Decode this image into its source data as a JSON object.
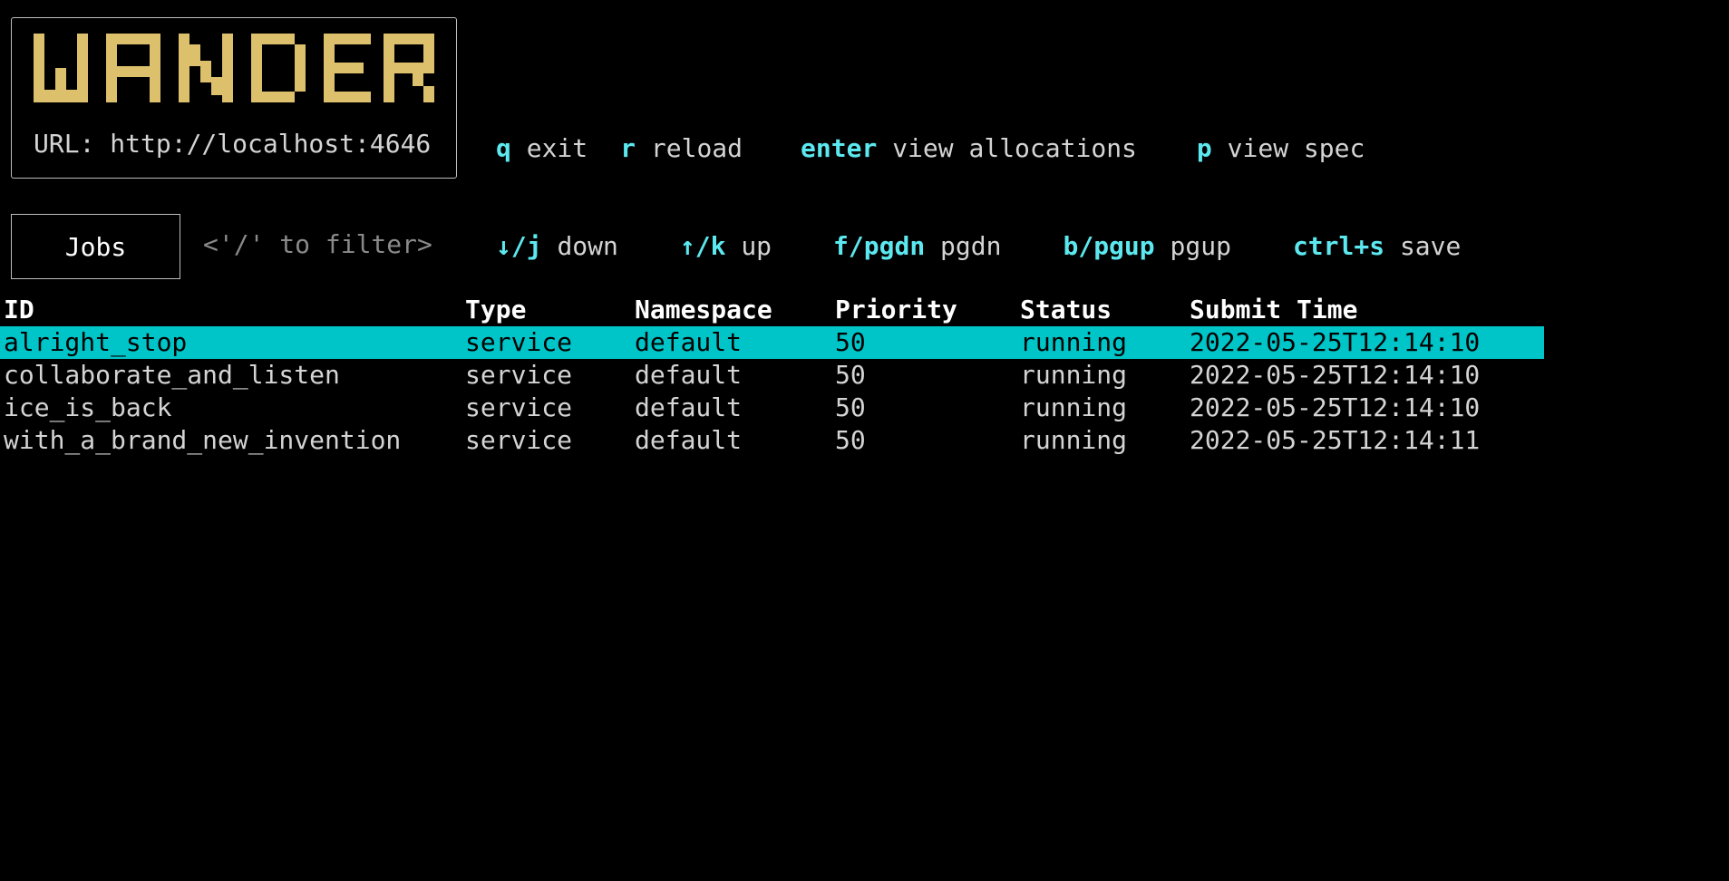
{
  "header": {
    "logo_text": "WANDER",
    "logo_color": "#dcc06c",
    "url_label": "URL: http://localhost:4646"
  },
  "keybindings": {
    "row1": [
      {
        "key": "q",
        "desc": "exit"
      },
      {
        "key": "r",
        "desc": "reload"
      },
      {
        "key": "enter",
        "desc": "view allocations"
      },
      {
        "key": "p",
        "desc": "view spec"
      }
    ],
    "row2": [
      {
        "key": "↓/j",
        "desc": "down"
      },
      {
        "key": "↑/k",
        "desc": "up"
      },
      {
        "key": "f/pgdn",
        "desc": "pgdn"
      },
      {
        "key": "b/pgup",
        "desc": "pgup"
      },
      {
        "key": "ctrl+s",
        "desc": "save"
      }
    ],
    "key_color": "#5ce8ef"
  },
  "view": {
    "tab_label": "Jobs",
    "filter_placeholder": "<'/' to filter>"
  },
  "table": {
    "columns": [
      "ID",
      "Type",
      "Namespace",
      "Priority",
      "Status",
      "Submit Time"
    ],
    "rows": [
      [
        "alright_stop",
        "service",
        "default",
        "50",
        "running",
        "2022-05-25T12:14:10"
      ],
      [
        "collaborate_and_listen",
        "service",
        "default",
        "50",
        "running",
        "2022-05-25T12:14:10"
      ],
      [
        "ice_is_back",
        "service",
        "default",
        "50",
        "running",
        "2022-05-25T12:14:10"
      ],
      [
        "with_a_brand_new_invention",
        "service",
        "default",
        "50",
        "running",
        "2022-05-25T12:14:11"
      ]
    ],
    "selected_row": 0,
    "selection_color": "#00c5c8"
  }
}
